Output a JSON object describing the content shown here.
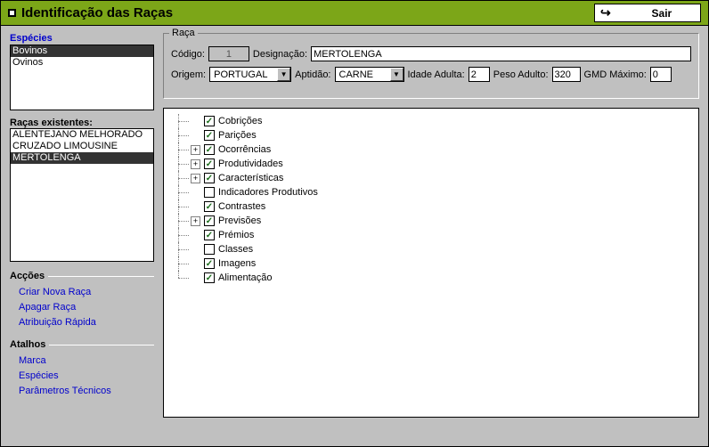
{
  "titlebar": {
    "caption": "Identificação das Raças",
    "exit_label": "Sair"
  },
  "sidebar": {
    "species_title": "Espécies",
    "species": [
      {
        "label": "Bovinos",
        "selected": true
      },
      {
        "label": "Ovinos",
        "selected": false
      }
    ],
    "races_title": "Raças existentes:",
    "races": [
      {
        "label": "ALENTEJANO MELHORADO",
        "selected": false
      },
      {
        "label": "CRUZADO LIMOUSINE",
        "selected": false
      },
      {
        "label": "MERTOLENGA",
        "selected": true
      }
    ],
    "actions_title": "Acções",
    "actions": [
      {
        "label": "Criar Nova Raça"
      },
      {
        "label": "Apagar Raça"
      },
      {
        "label": "Atribuição Rápida"
      }
    ],
    "shortcuts_title": "Atalhos",
    "shortcuts": [
      {
        "label": "Marca"
      },
      {
        "label": "Espécies"
      },
      {
        "label": "Parâmetros Técnicos"
      }
    ]
  },
  "race_panel": {
    "legend": "Raça",
    "codigo_label": "Código:",
    "codigo_value": "1",
    "designacao_label": "Designação:",
    "designacao_value": "MERTOLENGA",
    "origem_label": "Origem:",
    "origem_value": "PORTUGAL",
    "aptidao_label": "Aptidão:",
    "aptidao_value": "CARNE",
    "idade_label": "Idade Adulta:",
    "idade_value": "2",
    "peso_label": "Peso Adulto:",
    "peso_value": "320",
    "gmd_label": "GMD Máximo:",
    "gmd_value": "0"
  },
  "tree": [
    {
      "label": "Cobrições",
      "checked": true,
      "expandable": false
    },
    {
      "label": "Parições",
      "checked": true,
      "expandable": false
    },
    {
      "label": "Ocorrências",
      "checked": true,
      "expandable": true
    },
    {
      "label": "Produtividades",
      "checked": true,
      "expandable": true
    },
    {
      "label": "Características",
      "checked": true,
      "expandable": true
    },
    {
      "label": "Indicadores Produtivos",
      "checked": false,
      "expandable": false
    },
    {
      "label": "Contrastes",
      "checked": true,
      "expandable": false
    },
    {
      "label": "Previsões",
      "checked": true,
      "expandable": true
    },
    {
      "label": "Prémios",
      "checked": true,
      "expandable": false
    },
    {
      "label": "Classes",
      "checked": false,
      "expandable": false
    },
    {
      "label": "Imagens",
      "checked": true,
      "expandable": false
    },
    {
      "label": "Alimentação",
      "checked": true,
      "expandable": false
    }
  ]
}
